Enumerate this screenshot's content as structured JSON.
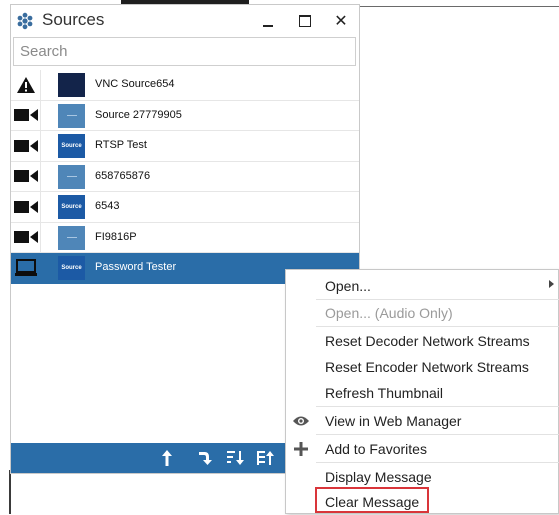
{
  "window": {
    "title": "Sources",
    "close_glyph": "✕"
  },
  "search": {
    "placeholder": "Search",
    "value": ""
  },
  "sources": [
    {
      "name": "VNC Source654",
      "status_icon": "warning-icon",
      "thumb": "dark"
    },
    {
      "name": "Source 27779905",
      "status_icon": "camera-icon",
      "thumb": "lines"
    },
    {
      "name": "RTSP Test",
      "status_icon": "camera-icon",
      "thumb": "badge",
      "thumb_text": "Source"
    },
    {
      "name": "658765876",
      "status_icon": "camera-icon",
      "thumb": "lines"
    },
    {
      "name": "6543",
      "status_icon": "camera-icon",
      "thumb": "badge",
      "thumb_text": "Source"
    },
    {
      "name": "FI9816P",
      "status_icon": "camera-icon",
      "thumb": "lines"
    },
    {
      "name": "Password Tester",
      "status_icon": "monitor-icon",
      "thumb": "badge",
      "thumb_text": "Source",
      "selected": true
    }
  ],
  "toolbar_icons": [
    "upload-arrow-icon",
    "redirect-arrow-icon",
    "sort-ascending-icon",
    "sort-filter-icon"
  ],
  "context_menu": {
    "items": [
      {
        "label": "Open...",
        "enabled": true,
        "submenu": true
      },
      {
        "label": "Open... (Audio Only)",
        "enabled": false
      },
      {
        "label": "Reset Decoder Network Streams",
        "enabled": true
      },
      {
        "label": "Reset Encoder Network Streams",
        "enabled": true
      },
      {
        "label": "Refresh Thumbnail",
        "enabled": true
      },
      {
        "label": "View in Web Manager",
        "enabled": true,
        "icon": "eye-icon"
      },
      {
        "label": "Add to Favorites",
        "enabled": true,
        "icon": "plus-icon"
      },
      {
        "label": "Display Message",
        "enabled": true
      },
      {
        "label": "Clear Message",
        "enabled": true,
        "highlighted": true
      }
    ]
  },
  "colors": {
    "accent": "#2a6da8",
    "highlight_border": "#d9353a",
    "thumb_dark": "#13244a",
    "thumb_badge": "#1c5aa5"
  }
}
